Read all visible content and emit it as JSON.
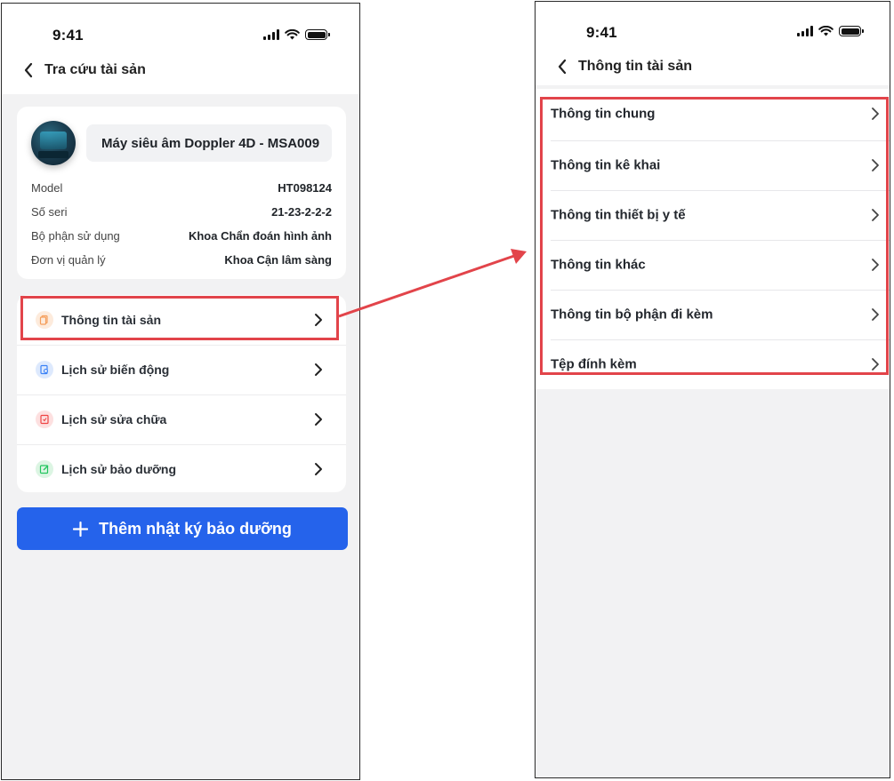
{
  "left_screen": {
    "status_time": "9:41",
    "nav_title": "Tra cứu tài sản",
    "asset": {
      "name": "Máy siêu âm Doppler 4D - MSA009",
      "fields": [
        {
          "label": "Model",
          "value": "HT098124"
        },
        {
          "label": "Số seri",
          "value": "21-23-2-2-2"
        },
        {
          "label": "Bộ phận sử dụng",
          "value": "Khoa Chẩn đoán hình ảnh"
        },
        {
          "label": "Đơn vị quản lý",
          "value": "Khoa Cận lâm sàng"
        }
      ]
    },
    "menu": [
      {
        "label": "Thông tin tài sản",
        "icon": "document-icon",
        "color": "#f59e5b"
      },
      {
        "label": "Lịch sử biến động",
        "icon": "search-document-icon",
        "color": "#3b82f6"
      },
      {
        "label": "Lịch sử sửa chữa",
        "icon": "repair-document-icon",
        "color": "#ef4444"
      },
      {
        "label": "Lịch sử bảo dưỡng",
        "icon": "edit-document-icon",
        "color": "#22c55e"
      }
    ],
    "primary_button": "Thêm nhật ký bảo dưỡng"
  },
  "right_screen": {
    "status_time": "9:41",
    "nav_title": "Thông tin tài sản",
    "items": [
      "Thông tin chung",
      "Thông tin kê khai",
      "Thông tin thiết bị y tế",
      "Thông tin khác",
      "Thông tin bộ phận đi kèm",
      "Tệp đính kèm"
    ]
  },
  "colors": {
    "primary": "#2563eb",
    "highlight": "#e2444a",
    "background": "#f2f2f3"
  }
}
